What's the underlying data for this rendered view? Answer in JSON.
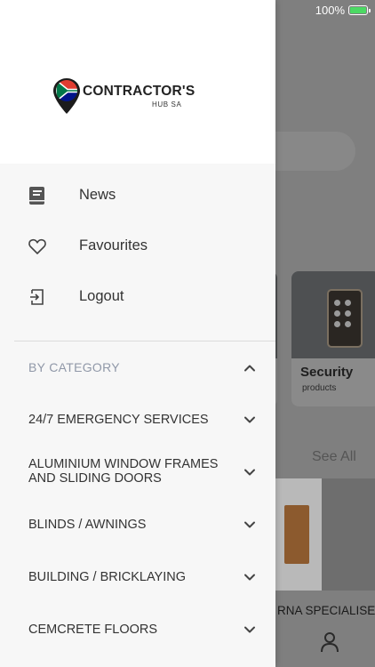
{
  "status_bar": {
    "battery_percent": "100%"
  },
  "background": {
    "card_security": {
      "title": "Security",
      "subtitle": "products"
    },
    "see_all": "See All",
    "featured_title": "RNA SPECIALISE"
  },
  "drawer": {
    "logo": {
      "name": "CONTRACTOR'S",
      "sub": "HUB SA"
    },
    "menu": [
      {
        "label": "News",
        "icon": "book-icon"
      },
      {
        "label": "Favourites",
        "icon": "heart-icon"
      },
      {
        "label": "Logout",
        "icon": "logout-icon"
      }
    ],
    "category_header": "BY CATEGORY",
    "categories": [
      "24/7 EMERGENCY SERVICES",
      "ALUMINIUM WINDOW FRAMES AND SLIDING DOORS",
      "BLINDS / AWNINGS",
      "BUILDING / BRICKLAYING",
      "CEMCRETE FLOORS"
    ]
  },
  "colors": {
    "drawer_bg": "#f7f7f7",
    "header_bg": "#ffffff",
    "text": "#333333",
    "category_header": "#9098a8",
    "battery": "#4cd964"
  }
}
